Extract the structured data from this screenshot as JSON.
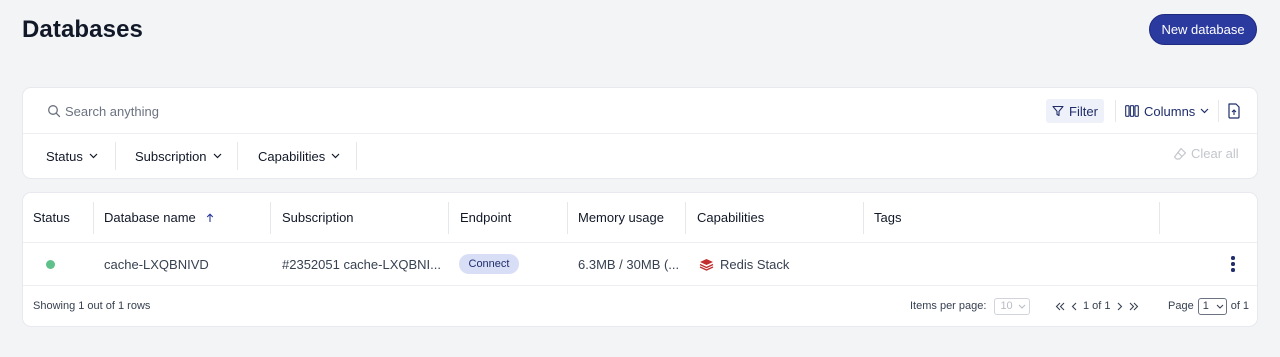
{
  "header": {
    "title": "Databases",
    "new_button": "New database"
  },
  "toolbar": {
    "search_placeholder": "Search anything",
    "filter_label": "Filter",
    "columns_label": "Columns",
    "filters": [
      "Status",
      "Subscription",
      "Capabilities"
    ],
    "clear_all": "Clear all"
  },
  "table": {
    "columns": [
      "Status",
      "Database name",
      "Subscription",
      "Endpoint",
      "Memory usage",
      "Capabilities",
      "Tags"
    ],
    "sorted_column": "Database name",
    "rows": [
      {
        "status": "active",
        "database_name": "cache-LXQBNIVD",
        "subscription": "#2352051 cache-LXQBNI...",
        "endpoint": "Connect",
        "memory_usage": "6.3MB / 30MB (...",
        "capabilities": "Redis Stack",
        "tags": ""
      }
    ]
  },
  "footer": {
    "showing": "Showing 1 out of 1 rows",
    "items_per_page_label": "Items per page:",
    "items_per_page": "10",
    "range": "1 of 1",
    "page_label": "Page",
    "page": "1",
    "page_total": "of 1"
  },
  "colors": {
    "primary": "#2b3a9f",
    "status_ok": "#5fc08a",
    "connect_bg": "#d8def5"
  }
}
